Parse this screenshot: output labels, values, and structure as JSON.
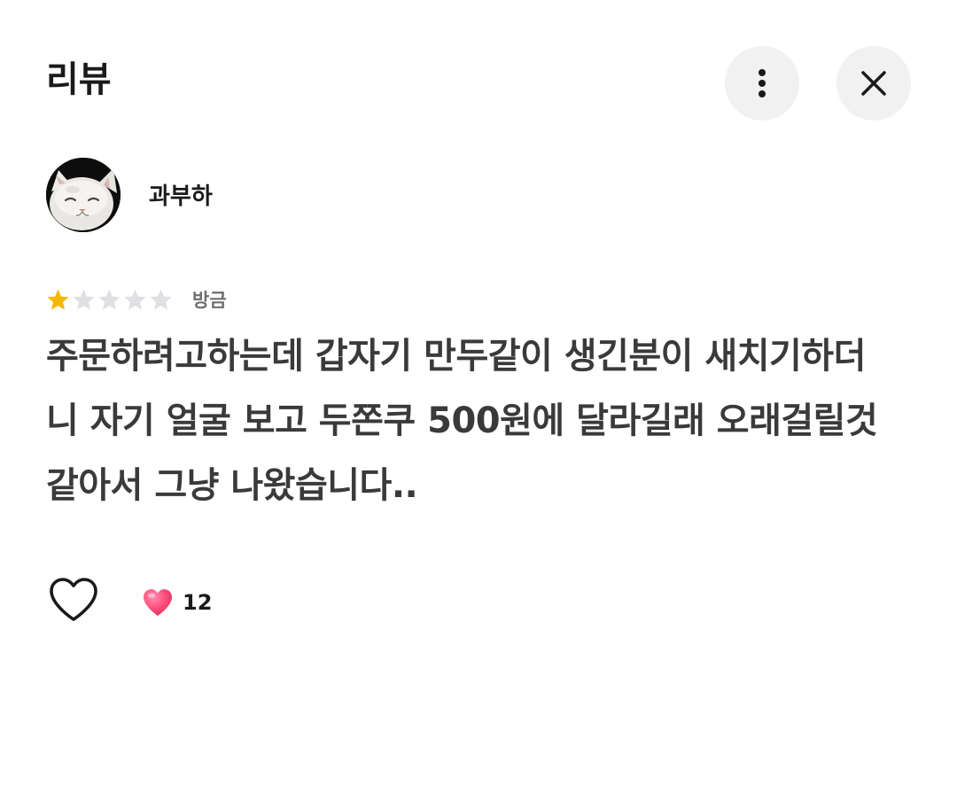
{
  "header": {
    "title": "리뷰",
    "more_icon": "more-vertical-icon",
    "close_icon": "close-icon"
  },
  "review": {
    "user_name": "과부하",
    "avatar_icon": "cat-avatar",
    "rating": 1,
    "rating_max": 5,
    "time_ago": "방금",
    "text": "주문하려고하는데 갑자기 만두같이 생긴분이 새치기하더니 자기 얼굴 보고 두쫀쿠 500원에 달라길래 오래걸릴것같아서 그냥 나왔습니다..",
    "like_icon": "heart-outline-icon",
    "like_count_icon": "heart-filled-icon",
    "like_count": "12"
  },
  "colors": {
    "star_filled": "#F5B800",
    "star_empty": "#E0E0E4",
    "button_bg": "#F1F1F1",
    "heart_pink": "#FF4F7B"
  }
}
